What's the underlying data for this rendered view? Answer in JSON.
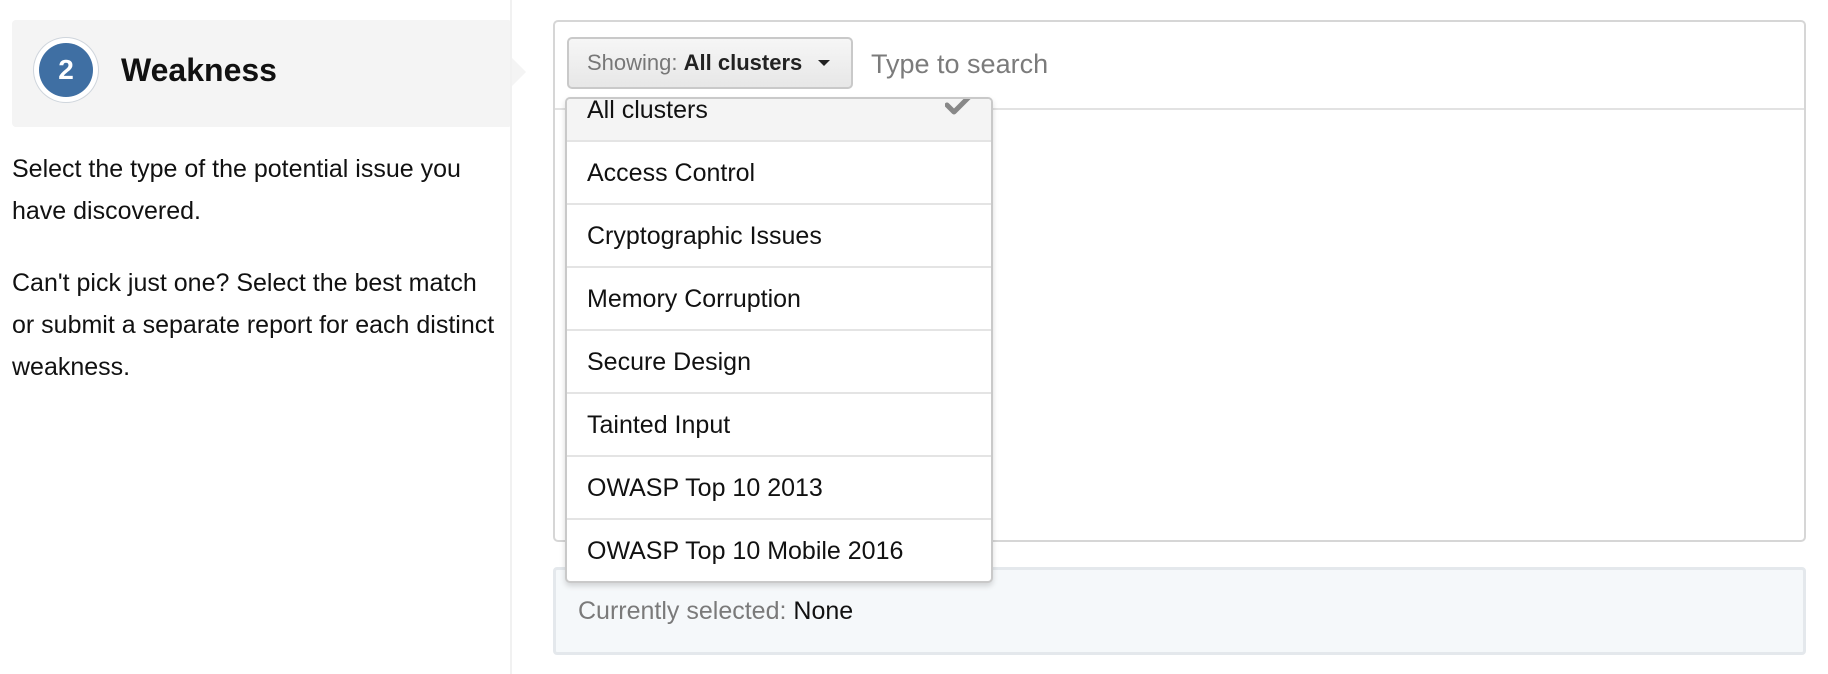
{
  "step": {
    "number": "2",
    "title": "Weakness",
    "help_1": "Select the type of the potential issue you have discovered.",
    "help_2": "Can't pick just one? Select the best match or submit a separate report for each distinct weakness."
  },
  "filter": {
    "prefix": "Showing:",
    "value": "All clusters"
  },
  "search": {
    "placeholder": "Type to search",
    "value": ""
  },
  "dropdown": {
    "items": [
      {
        "label": "All clusters",
        "selected": true
      },
      {
        "label": "Access Control"
      },
      {
        "label": "Cryptographic Issues"
      },
      {
        "label": "Memory Corruption"
      },
      {
        "label": "Secure Design"
      },
      {
        "label": "Tainted Input"
      },
      {
        "label": "OWASP Top 10 2013"
      },
      {
        "label": "OWASP Top 10 Mobile 2016"
      }
    ]
  },
  "selection": {
    "label": "Currently selected:",
    "value": "None"
  },
  "colors": {
    "step_badge": "#3f6fa3",
    "selected_bar_bg": "#f5f8fa"
  }
}
